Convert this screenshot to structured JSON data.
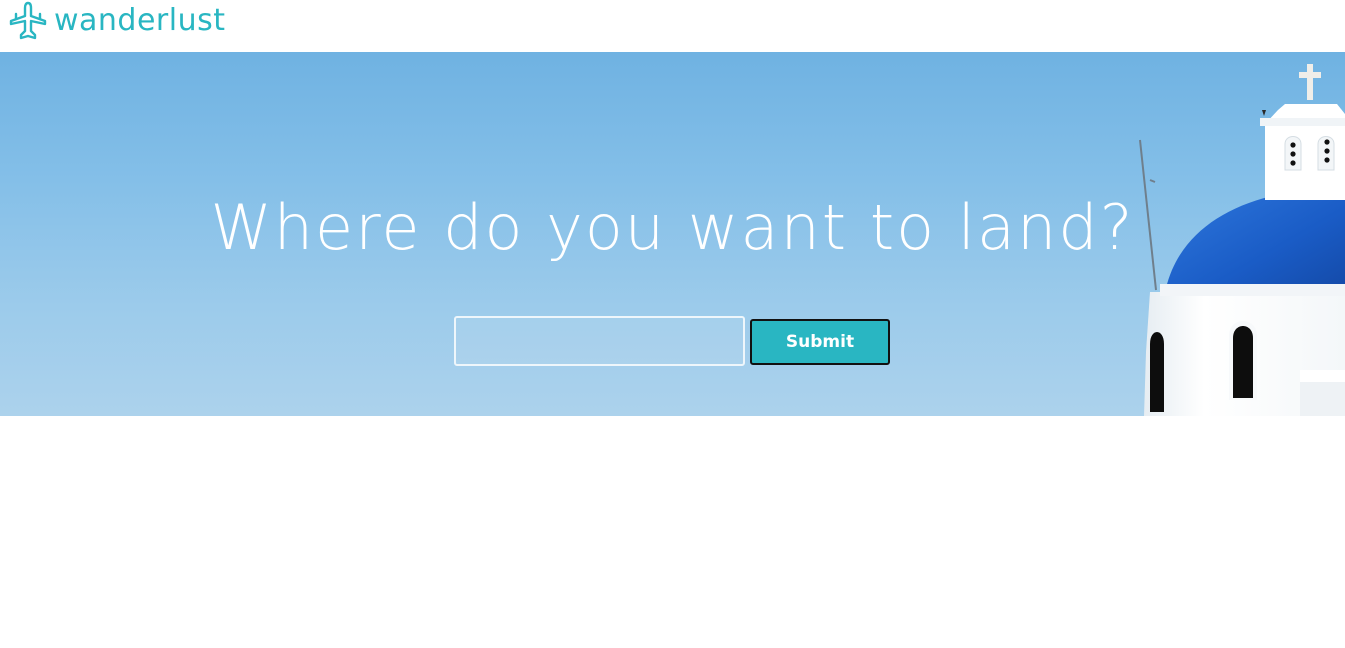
{
  "header": {
    "logo_icon": "airplane-icon",
    "logo_text": "wanderlust",
    "brand_color": "#29b6c2"
  },
  "hero": {
    "headline": "Where do you want to land?",
    "search": {
      "value": "",
      "placeholder": ""
    },
    "submit_label": "Submit",
    "sky_color": "#84bfe8",
    "dome_color": "#1e5fc9"
  }
}
